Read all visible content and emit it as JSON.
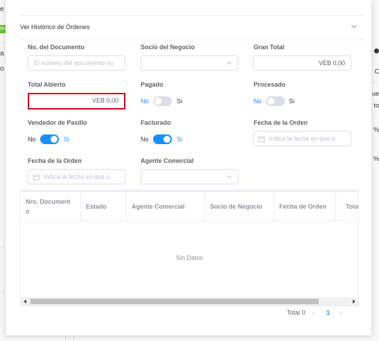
{
  "background": {
    "top_left_text": "e",
    "tag_text": "do",
    "left_a": "a",
    "left_o": "o",
    "right_ue": "ue",
    "right_to": "to",
    "right_c": "C",
    "right_pct1": "%",
    "right_pct2": "%"
  },
  "collapse": {
    "title": "Ver Histórico de Órdenes"
  },
  "form": {
    "doc_no": {
      "label": "No. del Documento",
      "placeholder": "El número del documento es"
    },
    "business_partner": {
      "label": "Socio del Negocio",
      "value": ""
    },
    "grand_total": {
      "label": "Gran Total",
      "value": "VEB 0,00"
    },
    "open_amount": {
      "label": "Total Abierto",
      "value": "VEB 0,00"
    },
    "paid": {
      "label": "Pagado",
      "off": "No",
      "on": "Si",
      "state": false
    },
    "processed": {
      "label": "Procesado",
      "off": "No",
      "on": "Si",
      "state": false
    },
    "sales_rep": {
      "label": "Vendedor de Pasillo",
      "off": "No",
      "on": "Si",
      "state": true
    },
    "invoiced": {
      "label": "Facturado",
      "off": "No",
      "on": "Si",
      "state": true
    },
    "order_date_1": {
      "label": "Fecha de la Orden",
      "placeholder": "Indica la fecha en que u"
    },
    "order_date_2": {
      "label": "Fecha de la Orden",
      "placeholder": "Indica la fecha en que u"
    },
    "commercial_agent": {
      "label": "Agente Comercial",
      "value": ""
    }
  },
  "table": {
    "columns": [
      "Nro. Document o",
      "Estado",
      "Agente Comercial",
      "Socio de Negocio",
      "Fecha de Orden",
      "Tota"
    ],
    "empty_text": "Sin Datos"
  },
  "pagination": {
    "total": "Total 0",
    "current_page": "1"
  },
  "colors": {
    "primary": "#1890ff",
    "error": "#d0021b",
    "border": "#dcdfe6"
  }
}
